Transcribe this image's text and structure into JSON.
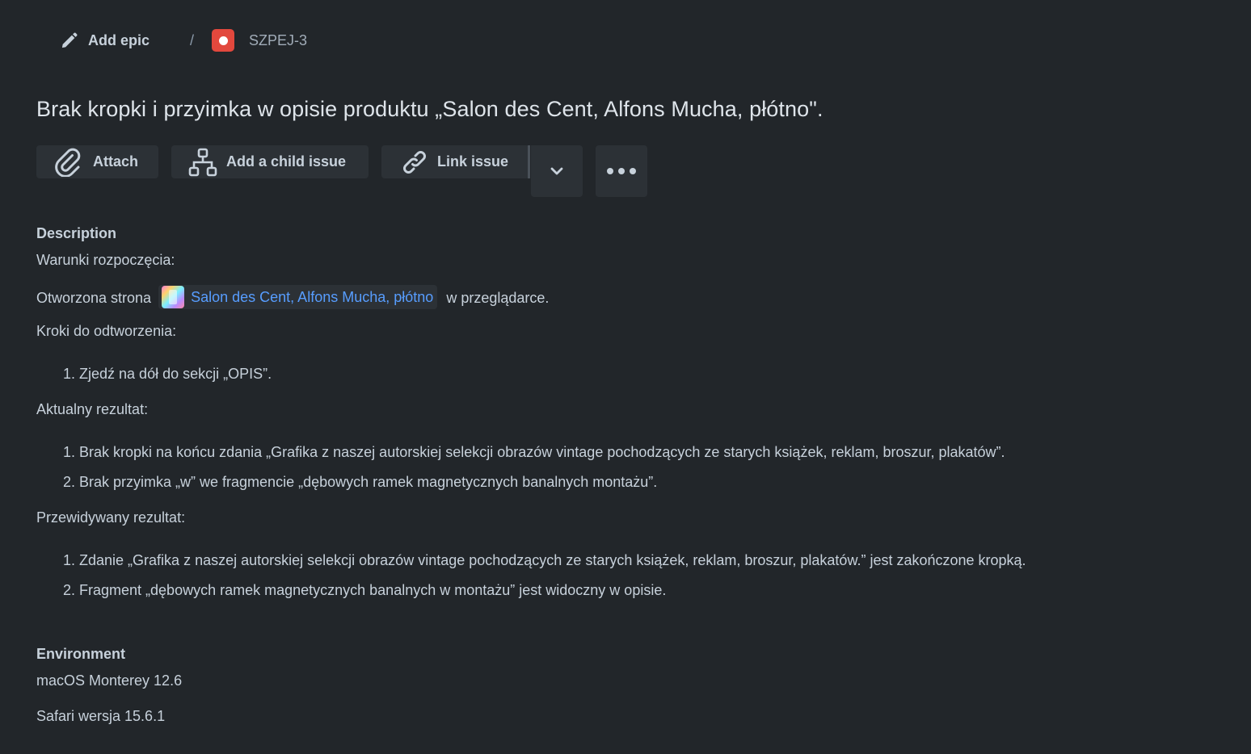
{
  "breadcrumb": {
    "epic_label": "Add epic",
    "separator": "/",
    "issue_key": "SZPEJ-3"
  },
  "issue": {
    "title": "Brak kropki i przyimka w opisie produktu „Salon des Cent, Alfons Mucha, płótno\"."
  },
  "toolbar": {
    "attach_label": "Attach",
    "child_issue_label": "Add a child issue",
    "link_issue_label": "Link issue"
  },
  "description": {
    "heading": "Description",
    "preconditions_label": "Warunki rozpoczęcia:",
    "opened_prefix": "Otworzona strona",
    "link_text": "Salon des Cent, Alfons Mucha, płótno",
    "opened_suffix": "w przeglądarce.",
    "steps_label": "Kroki do odtworzenia:",
    "steps": [
      {
        "num": "1.",
        "text": "Zjedź na dół do sekcji „OPIS”."
      }
    ],
    "actual_label": "Aktualny rezultat:",
    "actual": [
      {
        "num": "1.",
        "text": "Brak kropki na końcu zdania „Grafika z naszej autorskiej selekcji obrazów vintage pochodzących ze starych książek, reklam, broszur, plakatów”."
      },
      {
        "num": "2.",
        "text": "Brak przyimka „w” we fragmencie „dębowych ramek magnetycznych banalnych montażu”."
      }
    ],
    "expected_label": "Przewidywany rezultat:",
    "expected": [
      {
        "num": "1.",
        "text": "Zdanie „Grafika z naszej autorskiej selekcji obrazów vintage pochodzących ze starych książek, reklam, broszur, plakatów.” jest zakończone kropką."
      },
      {
        "num": "2.",
        "text": "Fragment „dębowych ramek magnetycznych banalnych w montażu” jest widoczny w opisie."
      }
    ]
  },
  "environment": {
    "heading": "Environment",
    "os": "macOS Monterey 12.6",
    "browser": "Safari wersja 15.6.1"
  },
  "colors": {
    "background": "#22262a",
    "text": "#c7d1db",
    "link": "#579dff",
    "button_bg": "#2c3136",
    "bug_red": "#e2483d"
  },
  "icons": {
    "epic": "pencil-icon",
    "issue_type": "bug-icon",
    "attach": "paperclip-icon",
    "child": "hierarchy-icon",
    "link": "link-icon",
    "dropdown": "chevron-down-icon",
    "more": "more-icon"
  }
}
